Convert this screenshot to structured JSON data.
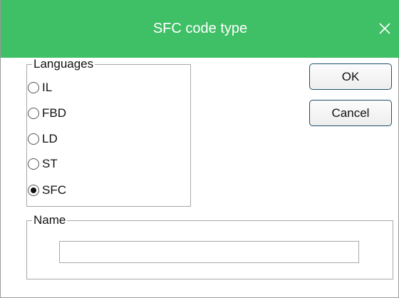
{
  "dialog": {
    "title": "SFC code type",
    "close_icon": "close-icon",
    "accent_color": "#3fbf66"
  },
  "languages": {
    "label": "Languages",
    "options": [
      "IL",
      "FBD",
      "LD",
      "ST",
      "SFC"
    ],
    "selected": "SFC"
  },
  "buttons": {
    "ok_label": "OK",
    "cancel_label": "Cancel"
  },
  "name": {
    "label": "Name",
    "value": ""
  }
}
